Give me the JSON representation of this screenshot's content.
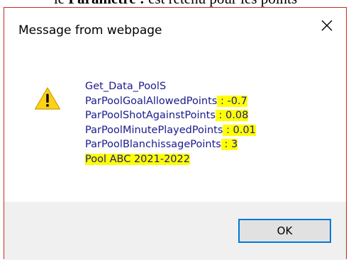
{
  "background": {
    "prefix": "le ",
    "bold": "Paramètre :",
    "suffix": " est retenu pour les points"
  },
  "dialog": {
    "title": "Message from webpage",
    "close_icon": "close-icon",
    "warning_icon": "warning-icon",
    "lines": [
      {
        "label": "Get_Data_PoolS",
        "value": ""
      },
      {
        "label": "ParPoolGoalAllowedPoints",
        "value": " : -0.7"
      },
      {
        "label": "ParPoolShotAgainstPoints",
        "value": " : 0.08"
      },
      {
        "label": "ParPoolMinutePlayedPoints",
        "value": " : 0.01"
      },
      {
        "label": "ParPoolBlanchissagePoints",
        "value": " : 3"
      },
      {
        "label": "Pool ABC 2021-2022",
        "value": ""
      }
    ],
    "ok_label": "OK"
  },
  "colors": {
    "highlight": "#ffff00",
    "message_text": "#1a1a8c",
    "dialog_border": "#c42b1c",
    "focus_border": "#0078d7"
  }
}
